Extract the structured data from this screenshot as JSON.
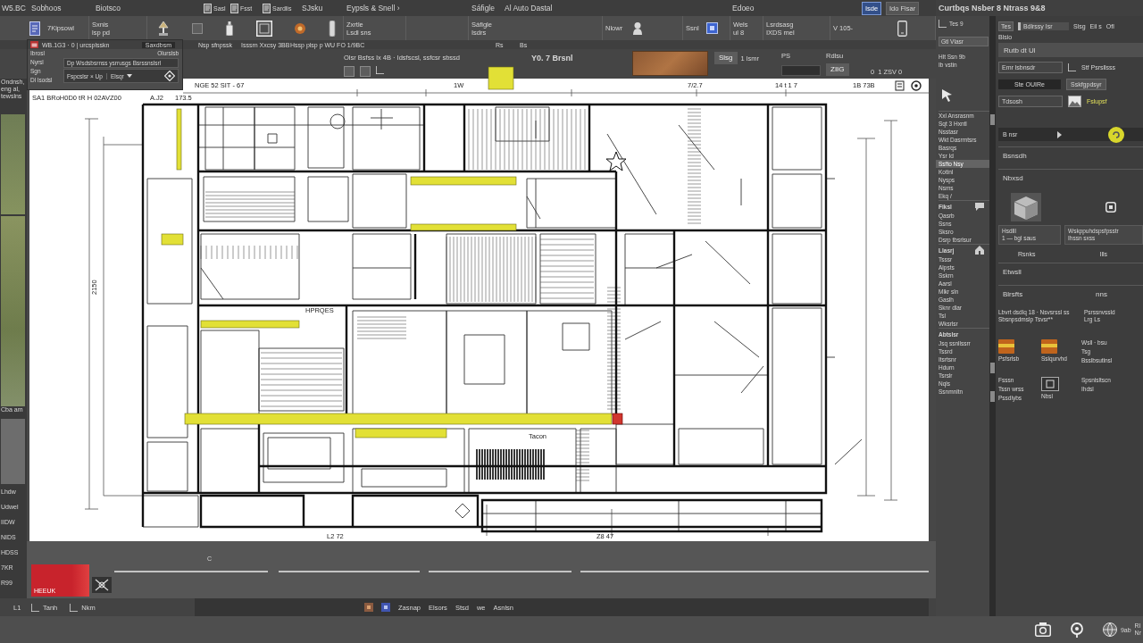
{
  "menu_row": [
    {
      "kind": "label",
      "text": "W5.BC"
    },
    {
      "kind": "label",
      "text": "Sobhoos"
    },
    {
      "kind": "label",
      "text": "Biotsco"
    },
    {
      "kind": "tool",
      "text": "Sasl"
    },
    {
      "kind": "tool",
      "text": "Fsst"
    },
    {
      "kind": "tool",
      "text": "Sardlis"
    },
    {
      "kind": "label",
      "text": "SJsku"
    },
    {
      "kind": "label",
      "text": "Eypsls & Snell ›"
    },
    {
      "kind": "label",
      "text": "Sáfigle"
    },
    {
      "kind": "label",
      "text": "Al Auto Dastal"
    },
    {
      "kind": "label",
      "text": "Edoeo"
    },
    {
      "kind": "toggle",
      "text": "Isde",
      "selected": true
    },
    {
      "kind": "toggle",
      "text": "Ido Fisar",
      "selected": false
    }
  ],
  "tool_row": [
    {
      "kind": "tool",
      "lines": [
        "7Kipsowl"
      ]
    },
    {
      "kind": "label",
      "lines": [
        "Sxnis",
        "lsp pd"
      ]
    },
    {
      "kind": "label",
      "lines": [
        "Zxrtle",
        "Lsdl sns"
      ]
    },
    {
      "kind": "label",
      "lines": [
        "Sáfigle",
        "Isdrs"
      ]
    },
    {
      "kind": "label",
      "lines": [
        "Nlowr"
      ]
    },
    {
      "kind": "label",
      "lines": [
        "Ssnl"
      ]
    },
    {
      "kind": "label",
      "lines": [
        "Wels",
        "ul 8"
      ]
    },
    {
      "kind": "label",
      "lines": [
        "Lsrdsasg",
        "IXDS mel"
      ]
    },
    {
      "kind": "label",
      "lines": [
        "V 105-"
      ]
    }
  ],
  "option_row": [
    "Nsp sfnpssk",
    "Isssrn Xxcsy 3BB",
    "Hssp plsp p WU FO 1/9BC",
    "Rs",
    "Bs"
  ],
  "floating_panel": {
    "title": "WB.1G3 · 0 | urcsplsskn",
    "chip": "Saxdbsm",
    "labels": [
      "Ibrosl",
      "Nyrsl",
      "Sgn",
      "Dl lsodsl"
    ],
    "note": "Olurslsb",
    "field_value": "Dp Wsdsbsrnss ysrrusgs Bsrssnslsrl",
    "option": "Fspcslsr × Up",
    "dropdown_value": "Elsqr"
  },
  "info_bar": {
    "text": "Olsr Bsfss lx 4B · Idsfscsl, ssfcsr sbssd",
    "title": "Y0. 7 Brsnl",
    "controls": [
      "Slsg",
      "1 lsmr",
      "PS",
      "Rdlsu",
      "ZIIG",
      "0",
      "1 ZSV 0"
    ]
  },
  "sheet": {
    "header": [
      "NGE 52 SIT - 67",
      "1W",
      "7/2.7",
      "14 t 1 7",
      "1B 73B"
    ],
    "title_block": [
      "SA1 BRoH0D0 tR H 02AVZ00",
      "A.J2",
      "173.5"
    ],
    "labels": [
      "2150",
      "HPRQES",
      "Tacon",
      "L2 72",
      "Z8 47"
    ]
  },
  "left_strip": {
    "top": [
      "Ondnsh,",
      "eng al,",
      "tewslns"
    ],
    "captions": [
      "Cba am",
      "Lhdw",
      "Udwel",
      "IIDW",
      "NIDS",
      "HDSS",
      "7KR",
      "R99"
    ]
  },
  "timeline": {
    "clip_label": "HEEUK",
    "marker": "C"
  },
  "status_bar": {
    "left": [
      "L1",
      "Tanh",
      "Nkm"
    ],
    "right": [
      "Zasnap",
      "Elsors",
      "Stsd",
      "we",
      "Asnlsn"
    ]
  },
  "right_header": "Curtbqs Nsber 8 Ntrass 9&8",
  "layer_list": {
    "top": [
      "Tes 9",
      "Gtl Vlasr",
      "Hlt Ssn 9b",
      "Ib vstin"
    ],
    "groups": [
      {
        "items": [
          {
            "text": "Xxl Ansrasnm",
            "selected": false
          },
          {
            "text": "Sqt 3 Hxntl",
            "selected": false
          },
          {
            "text": "Nsstasr",
            "selected": false
          },
          {
            "text": "Wkt Dasrmtsrs",
            "selected": false
          },
          {
            "text": "Basrqs",
            "selected": false
          },
          {
            "text": "Ysr Id",
            "selected": false
          },
          {
            "text": "Ssfto Nsy",
            "selected": true
          },
          {
            "text": "Kotinl",
            "selected": false
          },
          {
            "text": "Nysps",
            "selected": false
          },
          {
            "text": "Nsms",
            "selected": false
          },
          {
            "text": "Ekq /",
            "selected": false
          }
        ]
      },
      {
        "title": "Fiksl",
        "items": [
          {
            "text": "Qasrb",
            "selected": false
          },
          {
            "text": "Ssns",
            "selected": false
          },
          {
            "text": "Sksro",
            "selected": false
          },
          {
            "text": "Dsrp tbsrlsur",
            "selected": false
          }
        ]
      },
      {
        "title": "Llasrj",
        "items": [
          {
            "text": "Tsssr",
            "selected": false
          },
          {
            "text": "Alpsts",
            "selected": false
          },
          {
            "text": "Sskrn",
            "selected": false
          },
          {
            "text": "Aarsl",
            "selected": false
          },
          {
            "text": "Mlkr sln",
            "selected": false
          },
          {
            "text": "Gaslh",
            "selected": false
          },
          {
            "text": "Sknr dlar",
            "selected": false
          },
          {
            "text": "Tsl",
            "selected": false
          },
          {
            "text": "Wksrlsr",
            "selected": false
          }
        ]
      },
      {
        "title": "Abtslsr",
        "items": [
          {
            "text": "Jsq ssnllssrr",
            "selected": false
          },
          {
            "text": "Tssrd",
            "selected": false
          },
          {
            "text": "Itsrtsnr",
            "selected": false
          },
          {
            "text": "Hdurn",
            "selected": false
          },
          {
            "text": "Tsrslr",
            "selected": false
          },
          {
            "text": "Nqls",
            "selected": false
          },
          {
            "text": "Ssnmnltn",
            "selected": false
          }
        ]
      }
    ]
  },
  "properties": {
    "toolbar": [
      "Tes",
      "Bdlrssy Isr",
      "Slsg",
      "Eil s",
      "Ofl"
    ],
    "caption": "Blsio",
    "header": "Rutb dt Ul",
    "fields": [
      "Emr lsbnsdr",
      "Stf Psrsllsss",
      "Ste OUIRe",
      "Sskfgpdsyr",
      "Tdsosh",
      "Fslupsf"
    ],
    "bar": "B nsr",
    "sections": [
      "Bsnsdh",
      "Nbxsd"
    ],
    "cells": [
      [
        "Hsdlll",
        "1 — bgl saus"
      ],
      [
        "Wskppuhdspsfpsstr",
        "Ihssn sxss"
      ]
    ],
    "row": [
      "Rsnks",
      "Ills"
    ],
    "section_b": "Etwsll",
    "setting": {
      "label": "Blrsfts",
      "value": "nns"
    },
    "note": [
      [
        "Lbvrt dsdlq 18 · Nsvsrssl ss",
        "Sbsnpsdmslp Tsvsr**"
      ],
      [
        "Psrssnvssld",
        "Lrg Ls"
      ]
    ],
    "tiles": [
      {
        "kind": "icon",
        "caption": "Psfsrlsb"
      },
      {
        "kind": "icon",
        "caption": "Sslqurvhd"
      },
      {
        "kind": "text",
        "lines": [
          "Wsll · bsu",
          "Tsg"
        ],
        "caption": "Bsslbsutlnsl"
      },
      {
        "kind": "text",
        "lines": [
          "Fsssn",
          "Tssn wrss"
        ],
        "caption": "Pssdlybs"
      },
      {
        "kind": "icon",
        "caption": "Nbsl"
      },
      {
        "kind": "text",
        "lines": [
          "Spsnlsltscn",
          "Ihdsl"
        ]
      }
    ]
  },
  "taskbar": [
    "9ab",
    "Rl",
    "Nr"
  ]
}
